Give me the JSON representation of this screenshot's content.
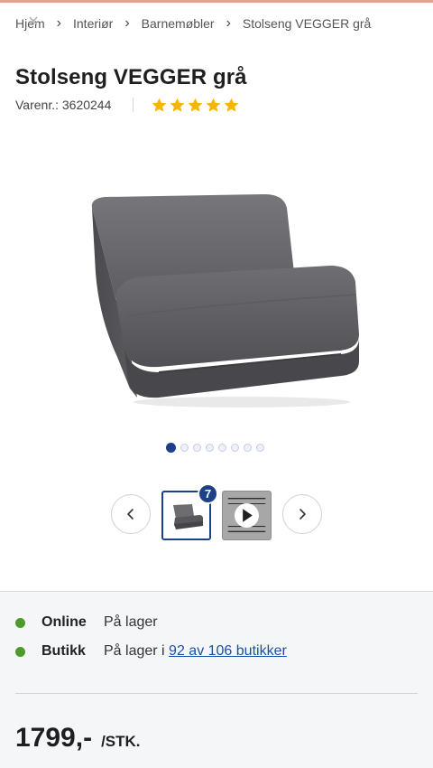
{
  "breadcrumb": {
    "items": [
      {
        "label": "Hjem"
      },
      {
        "label": "Interiør"
      },
      {
        "label": "Barnemøbler"
      },
      {
        "label": "Stolseng VEGGER grå"
      }
    ]
  },
  "product": {
    "title": "Stolseng VEGGER grå",
    "sku_label": "Varenr.: 3620244",
    "rating": 5,
    "rating_max": 5
  },
  "gallery": {
    "dots_count": 8,
    "active_index": 0,
    "image_count_badge": "7",
    "thumbnails": [
      {
        "type": "image",
        "icon": "chair-bed-thumbnail"
      },
      {
        "type": "video",
        "icon": "play-icon"
      }
    ],
    "prev_icon": "chevron-left-icon",
    "next_icon": "chevron-right-icon"
  },
  "availability": {
    "online": {
      "channel": "Online",
      "status": "På lager"
    },
    "store": {
      "channel": "Butikk",
      "status_prefix": "På lager i",
      "link": "92 av 106 butikker"
    }
  },
  "price": {
    "value": "1799,-",
    "unit": "/STK."
  },
  "colors": {
    "accent": "#1e3f8a",
    "star": "#f5b500",
    "in_stock": "#4c9a2a",
    "link": "#1e4fa8",
    "top_bar": "#e6a08e"
  }
}
